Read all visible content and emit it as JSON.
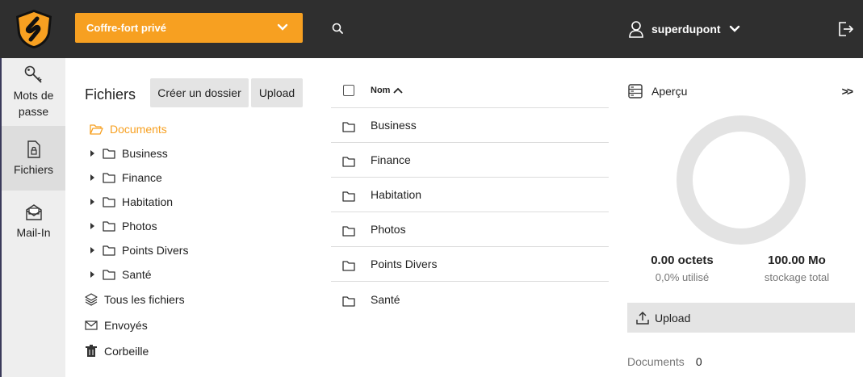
{
  "header": {
    "vault_label": "Coffre-fort privé",
    "username": "superdupont"
  },
  "nav": {
    "items": [
      {
        "label": "Mots de passe",
        "icon": "key-icon"
      },
      {
        "label": "Fichiers",
        "icon": "file-lock-icon",
        "active": true
      },
      {
        "label": "Mail-In",
        "icon": "mail-in-icon"
      }
    ]
  },
  "tree": {
    "title": "Fichiers",
    "create_folder_label": "Créer un dossier",
    "upload_label": "Upload",
    "root_label": "Documents",
    "folders": [
      "Business",
      "Finance",
      "Habitation",
      "Photos",
      "Points Divers",
      "Santé"
    ],
    "all_files_label": "Tous les fichiers",
    "sent_label": "Envoyés",
    "trash_label": "Corbeille"
  },
  "list": {
    "column_name": "Nom",
    "rows": [
      "Business",
      "Finance",
      "Habitation",
      "Photos",
      "Points Divers",
      "Santé"
    ]
  },
  "preview": {
    "title": "Aperçu",
    "collapse_label": ">>",
    "used_value": "0.00 octets",
    "used_label": "0,0% utilisé",
    "total_value": "100.00 Mo",
    "total_label": "stockage total",
    "usage_fraction": 0.0,
    "upload_label": "Upload",
    "docs_label": "Documents",
    "docs_count": "0"
  },
  "colors": {
    "accent": "#f7a021",
    "topbar": "#2f2f2f",
    "nav_bg": "#eeeeee",
    "donut": "#e3e3e3"
  }
}
